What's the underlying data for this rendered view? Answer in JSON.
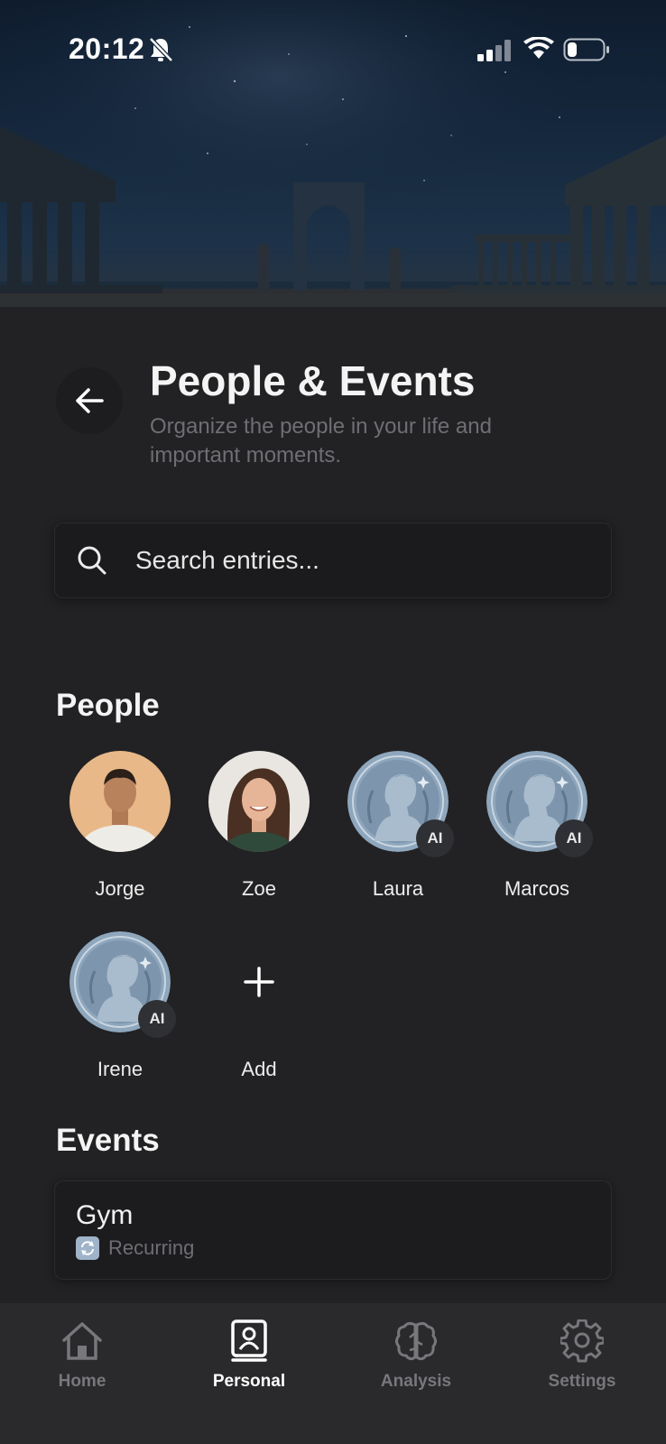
{
  "status_bar": {
    "time": "20:12",
    "icons": [
      "bell-slash-icon",
      "cellular-signal-icon",
      "wifi-icon",
      "battery-icon"
    ]
  },
  "header": {
    "title": "People & Events",
    "subtitle": "Organize the people in your life and important moments."
  },
  "search": {
    "placeholder": "Search entries..."
  },
  "people_section": {
    "title": "People",
    "people": [
      {
        "name": "Jorge",
        "avatar": "photo",
        "ai": false
      },
      {
        "name": "Zoe",
        "avatar": "photo",
        "ai": false
      },
      {
        "name": "Laura",
        "avatar": "classical-bust",
        "ai": true,
        "badge": "AI"
      },
      {
        "name": "Marcos",
        "avatar": "classical-bust",
        "ai": true,
        "badge": "AI"
      },
      {
        "name": "Irene",
        "avatar": "classical-bust",
        "ai": true,
        "badge": "AI"
      }
    ],
    "add_label": "Add"
  },
  "events_section": {
    "title": "Events",
    "events": [
      {
        "title": "Gym",
        "meta": "Recurring",
        "icon": "recurring-icon"
      }
    ]
  },
  "tab_bar": {
    "tabs": [
      {
        "label": "Home",
        "icon": "home-icon",
        "active": false
      },
      {
        "label": "Personal",
        "icon": "contact-book-icon",
        "active": true
      },
      {
        "label": "Analysis",
        "icon": "brain-icon",
        "active": false
      },
      {
        "label": "Settings",
        "icon": "gear-icon",
        "active": false
      }
    ]
  },
  "colors": {
    "background": "#222224",
    "card": "#1c1c1e",
    "muted_text": "#6e6e74",
    "tab_active": "#ffffff",
    "tab_inactive": "#77777c",
    "avatar_blue": "#8fa7bd"
  }
}
